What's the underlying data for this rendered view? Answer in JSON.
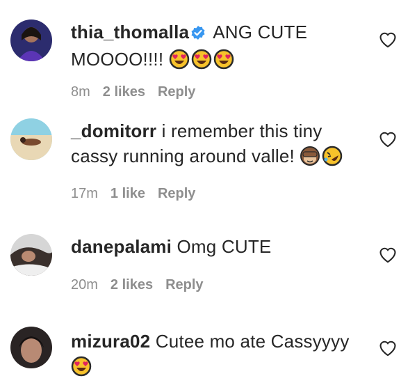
{
  "comments": [
    {
      "username": "thia_thomalla",
      "verified": true,
      "text": "ANG CUTE MOOOO!!!!",
      "emojis": [
        "heart-eyes",
        "heart-eyes",
        "heart-eyes"
      ],
      "time": "8m",
      "likes": "2 likes",
      "reply": "Reply",
      "avatar_colors": [
        "#1d3a8a",
        "#5a3a9a"
      ]
    },
    {
      "username": "_domitorr",
      "verified": false,
      "text": "i remember this tiny cassy running around valle!",
      "emojis": [
        "see-no-evil-monkey",
        "rolling-laughing"
      ],
      "time": "17m",
      "likes": "1 like",
      "reply": "Reply",
      "avatar_colors": [
        "#8fd1e3",
        "#e9d8b5"
      ]
    },
    {
      "username": "danepalami",
      "verified": false,
      "text": "Omg CUTE",
      "emojis": [],
      "time": "20m",
      "likes": "2 likes",
      "reply": "Reply",
      "avatar_colors": [
        "#cfcfcf",
        "#3a302c"
      ]
    },
    {
      "username": "mizura02",
      "verified": false,
      "text": "Cutee mo ate Cassyyyy",
      "emojis": [
        "heart-eyes"
      ],
      "time": "",
      "likes": "",
      "reply": "",
      "avatar_colors": [
        "#2a2424",
        "#b88a74"
      ]
    }
  ],
  "colors": {
    "verified": "#3897f0",
    "meta": "#8e8e8e",
    "text": "#262626"
  }
}
